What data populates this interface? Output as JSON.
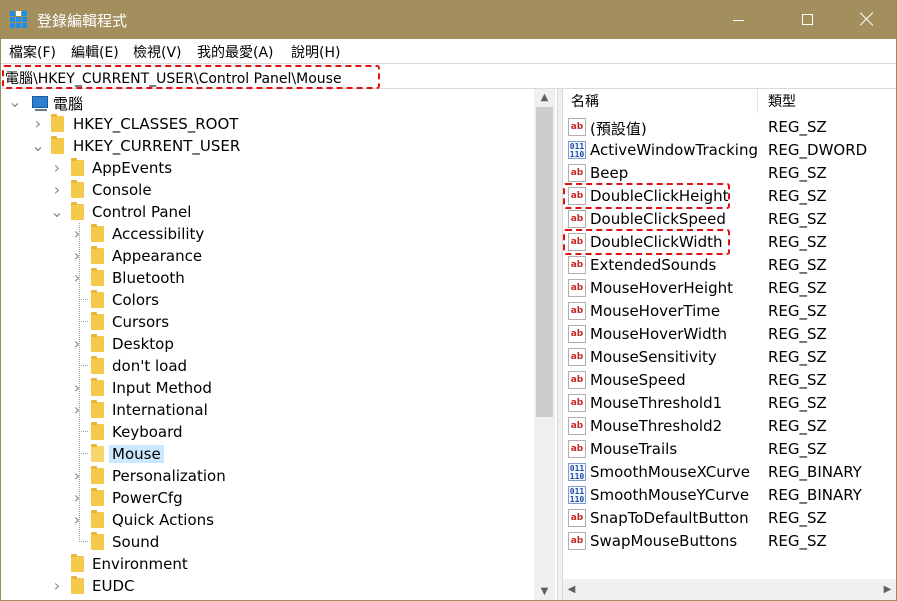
{
  "window": {
    "title": "登錄編輯程式",
    "controls": {
      "minimize": "minimize",
      "maximize": "maximize",
      "close": "close"
    }
  },
  "menu": [
    "檔案(F)",
    "編輯(E)",
    "檢視(V)",
    "我的最愛(A)",
    "說明(H)"
  ],
  "address": "電腦\\HKEY_CURRENT_USER\\Control Panel\\Mouse",
  "tree": [
    {
      "label": "電腦",
      "level": 0,
      "expander": "expanded",
      "icon": "computer-icon"
    },
    {
      "label": "HKEY_CLASSES_ROOT",
      "level": 1,
      "expander": "collapsed",
      "icon": "folder-icon"
    },
    {
      "label": "HKEY_CURRENT_USER",
      "level": 1,
      "expander": "expanded",
      "icon": "folder-icon"
    },
    {
      "label": "AppEvents",
      "level": 2,
      "expander": "collapsed",
      "icon": "folder-icon"
    },
    {
      "label": "Console",
      "level": 2,
      "expander": "collapsed",
      "icon": "folder-icon"
    },
    {
      "label": "Control Panel",
      "level": 2,
      "expander": "expanded",
      "icon": "folder-icon"
    },
    {
      "label": "Accessibility",
      "level": 3,
      "expander": "collapsed",
      "icon": "folder-icon"
    },
    {
      "label": "Appearance",
      "level": 3,
      "expander": "collapsed",
      "icon": "folder-icon"
    },
    {
      "label": "Bluetooth",
      "level": 3,
      "expander": "collapsed",
      "icon": "folder-icon"
    },
    {
      "label": "Colors",
      "level": 3,
      "expander": "none",
      "icon": "folder-icon"
    },
    {
      "label": "Cursors",
      "level": 3,
      "expander": "none",
      "icon": "folder-icon"
    },
    {
      "label": "Desktop",
      "level": 3,
      "expander": "collapsed",
      "icon": "folder-icon"
    },
    {
      "label": "don't load",
      "level": 3,
      "expander": "none",
      "icon": "folder-icon"
    },
    {
      "label": "Input Method",
      "level": 3,
      "expander": "collapsed",
      "icon": "folder-icon"
    },
    {
      "label": "International",
      "level": 3,
      "expander": "collapsed",
      "icon": "folder-icon"
    },
    {
      "label": "Keyboard",
      "level": 3,
      "expander": "none",
      "icon": "folder-icon"
    },
    {
      "label": "Mouse",
      "level": 3,
      "expander": "none",
      "icon": "folder-icon",
      "selected": true
    },
    {
      "label": "Personalization",
      "level": 3,
      "expander": "collapsed",
      "icon": "folder-icon"
    },
    {
      "label": "PowerCfg",
      "level": 3,
      "expander": "collapsed",
      "icon": "folder-icon"
    },
    {
      "label": "Quick Actions",
      "level": 3,
      "expander": "collapsed",
      "icon": "folder-icon"
    },
    {
      "label": "Sound",
      "level": 3,
      "expander": "none",
      "icon": "folder-icon"
    },
    {
      "label": "Environment",
      "level": 2,
      "expander": "none",
      "icon": "folder-icon"
    },
    {
      "label": "EUDC",
      "level": 2,
      "expander": "collapsed",
      "icon": "folder-icon"
    }
  ],
  "list": {
    "headers": {
      "name": "名稱",
      "type": "類型"
    },
    "rows": [
      {
        "name": "(預設值)",
        "type": "REG_SZ",
        "icon": "string-value-icon"
      },
      {
        "name": "ActiveWindowTracking",
        "type": "REG_DWORD",
        "icon": "binary-value-icon"
      },
      {
        "name": "Beep",
        "type": "REG_SZ",
        "icon": "string-value-icon"
      },
      {
        "name": "DoubleClickHeight",
        "type": "REG_SZ",
        "icon": "string-value-icon",
        "highlighted": true
      },
      {
        "name": "DoubleClickSpeed",
        "type": "REG_SZ",
        "icon": "string-value-icon"
      },
      {
        "name": "DoubleClickWidth",
        "type": "REG_SZ",
        "icon": "string-value-icon",
        "highlighted": true
      },
      {
        "name": "ExtendedSounds",
        "type": "REG_SZ",
        "icon": "string-value-icon"
      },
      {
        "name": "MouseHoverHeight",
        "type": "REG_SZ",
        "icon": "string-value-icon"
      },
      {
        "name": "MouseHoverTime",
        "type": "REG_SZ",
        "icon": "string-value-icon"
      },
      {
        "name": "MouseHoverWidth",
        "type": "REG_SZ",
        "icon": "string-value-icon"
      },
      {
        "name": "MouseSensitivity",
        "type": "REG_SZ",
        "icon": "string-value-icon"
      },
      {
        "name": "MouseSpeed",
        "type": "REG_SZ",
        "icon": "string-value-icon"
      },
      {
        "name": "MouseThreshold1",
        "type": "REG_SZ",
        "icon": "string-value-icon"
      },
      {
        "name": "MouseThreshold2",
        "type": "REG_SZ",
        "icon": "string-value-icon"
      },
      {
        "name": "MouseTrails",
        "type": "REG_SZ",
        "icon": "string-value-icon"
      },
      {
        "name": "SmoothMouseXCurve",
        "type": "REG_BINARY",
        "icon": "binary-value-icon"
      },
      {
        "name": "SmoothMouseYCurve",
        "type": "REG_BINARY",
        "icon": "binary-value-icon"
      },
      {
        "name": "SnapToDefaultButton",
        "type": "REG_SZ",
        "icon": "string-value-icon"
      },
      {
        "name": "SwapMouseButtons",
        "type": "REG_SZ",
        "icon": "string-value-icon"
      }
    ]
  },
  "icons": {
    "string_glyph": "ab",
    "binary_glyph": "011\n110"
  },
  "colors": {
    "titlebar": "#a38e5e",
    "highlight": "#e01010",
    "selection": "#cce8ff"
  }
}
